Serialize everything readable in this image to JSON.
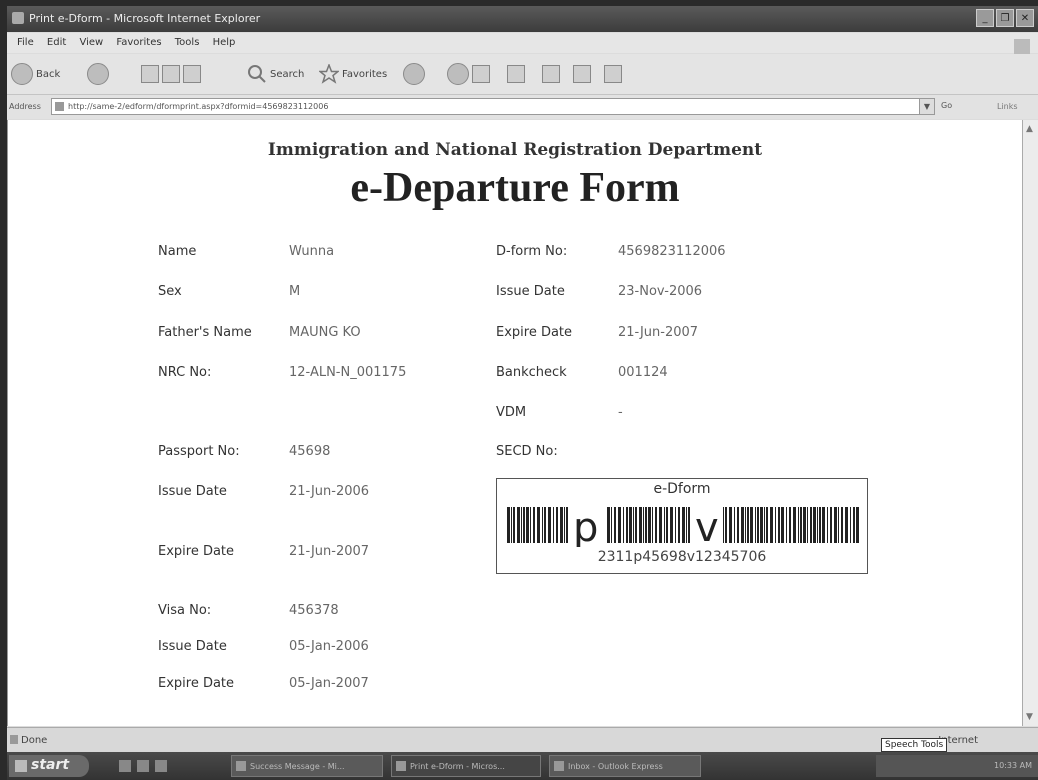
{
  "window": {
    "title": "Print e-Dform - Microsoft Internet Explorer",
    "buttons": [
      "_",
      "❐",
      "✕"
    ]
  },
  "menu": [
    "File",
    "Edit",
    "View",
    "Favorites",
    "Tools",
    "Help"
  ],
  "toolbar": {
    "back": "Back",
    "search": "Search",
    "favorites": "Favorites"
  },
  "address": {
    "label": "Address",
    "url": "http://same-2/edform/dformprint.aspx?dformid=4569823112006",
    "go": "Go",
    "links": "Links"
  },
  "page": {
    "department": "Immigration and National Registration Department",
    "form_title": "e-Departure Form",
    "left_fields": [
      {
        "label": "Name",
        "value": "Wunna"
      },
      {
        "label": "Sex",
        "value": "M"
      },
      {
        "label": "Father's Name",
        "value": "MAUNG KO"
      },
      {
        "label": "NRC No:",
        "value": "12-ALN-N_001175"
      },
      {
        "label": "Passport No:",
        "value": "45698"
      },
      {
        "label": "Issue Date",
        "value": "21-Jun-2006"
      },
      {
        "label": "Expire Date",
        "value": "21-Jun-2007"
      },
      {
        "label": "Visa No:",
        "value": "456378"
      },
      {
        "label": "Issue Date",
        "value": "05-Jan-2006"
      },
      {
        "label": "Expire Date",
        "value": "05-Jan-2007"
      }
    ],
    "right_fields": [
      {
        "label": "D-form No:",
        "value": "4569823112006"
      },
      {
        "label": "Issue Date",
        "value": "23-Nov-2006"
      },
      {
        "label": "Expire Date",
        "value": "21-Jun-2007"
      },
      {
        "label": "Bankcheck",
        "value": "001124"
      },
      {
        "label": "VDM",
        "value": "-"
      },
      {
        "label": "SECD No:",
        "value": ""
      }
    ],
    "barcode": {
      "title": "e-Dform",
      "letter_1": "p",
      "letter_2": "v",
      "digits": "2311p45698v12345706"
    }
  },
  "status": {
    "text": "Done",
    "zone": "Internet",
    "tooltip": "Speech Tools"
  },
  "taskbar": {
    "start": "start",
    "tasks": [
      "Success Message - Mi...",
      "Print e-Dform - Micros...",
      "Inbox - Outlook Express"
    ],
    "clock": "10:33 AM"
  }
}
